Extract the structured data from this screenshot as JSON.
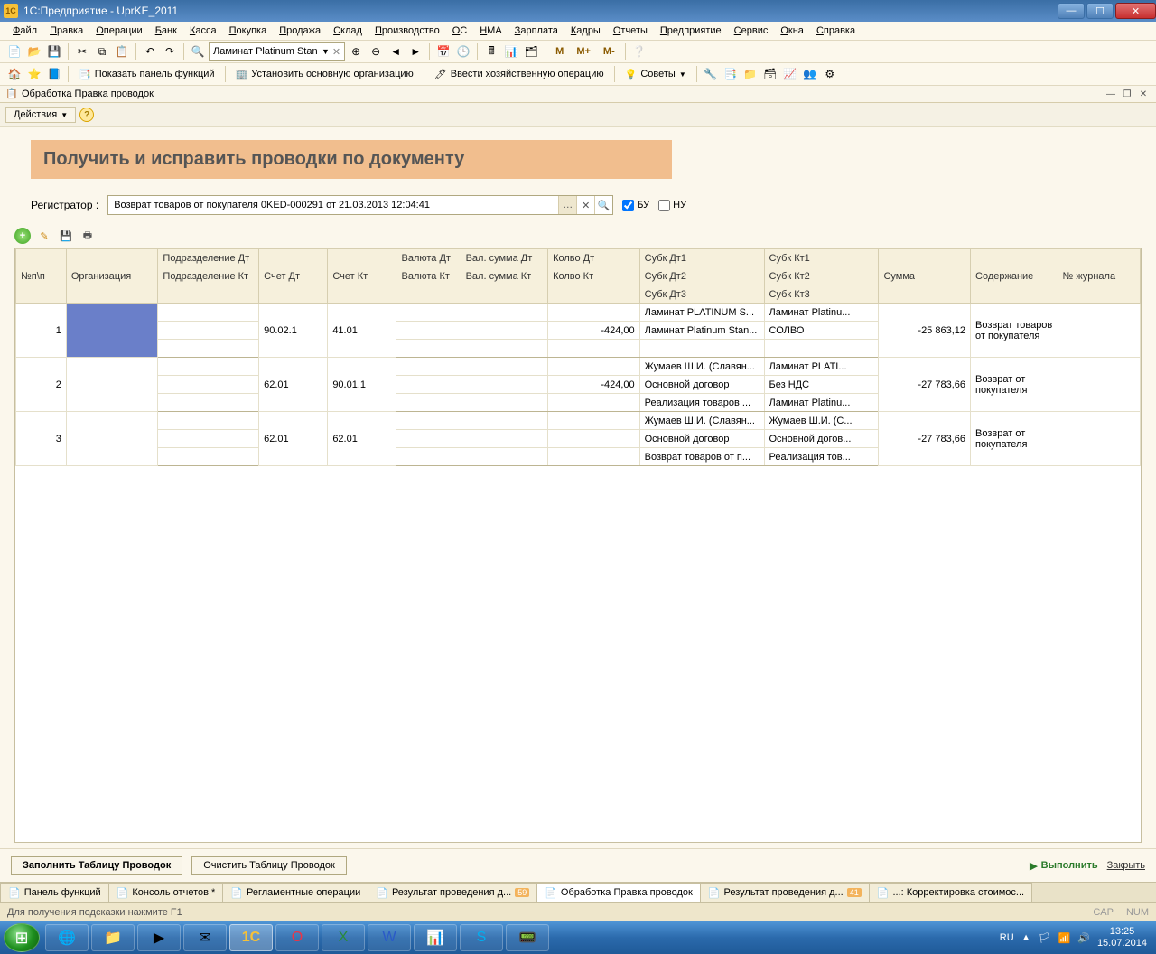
{
  "window": {
    "title": "1С:Предприятие - UprKE_2011"
  },
  "menu": [
    "Файл",
    "Правка",
    "Операции",
    "Банк",
    "Касса",
    "Покупка",
    "Продажа",
    "Склад",
    "Производство",
    "ОС",
    "НМА",
    "Зарплата",
    "Кадры",
    "Отчеты",
    "Предприятие",
    "Сервис",
    "Окна",
    "Справка"
  ],
  "toolbar1": {
    "combo_value": "Ламинат Platinum Stan",
    "m_labels": [
      "M",
      "M+",
      "M-"
    ]
  },
  "toolbar2": {
    "show_panel": "Показать панель функций",
    "set_org": "Установить основную организацию",
    "enter_op": "Ввести хозяйственную операцию",
    "tips": "Советы"
  },
  "subwin": {
    "title": "Обработка  Правка проводок"
  },
  "actions": {
    "label": "Действия"
  },
  "banner": "Получить и исправить проводки по документу",
  "registrator": {
    "label": "Регистратор :",
    "value": "Возврат товаров от покупателя 0KED-000291 от 21.03.2013 12:04:41",
    "bu": "БУ",
    "nu": "НУ"
  },
  "grid": {
    "headers": {
      "n": "№п\\п",
      "org": "Организация",
      "podr_dt": "Подразделение Дт",
      "podr_kt": "Подразделение Кт",
      "sch_dt": "Счет Дт",
      "sch_kt": "Счет Кт",
      "val_dt": "Валюта Дт",
      "val_kt": "Валюта Кт",
      "vsum_dt": "Вал. сумма Дт",
      "vsum_kt": "Вал. сумма Кт",
      "kol_dt": "Колво Дт",
      "kol_kt": "Колво Кт",
      "sub_dt1": "Субк Дт1",
      "sub_dt2": "Субк Дт2",
      "sub_dt3": "Субк Дт3",
      "sub_kt1": "Субк Кт1",
      "sub_kt2": "Субк Кт2",
      "sub_kt3": "Субк Кт3",
      "sum": "Сумма",
      "content": "Содержание",
      "journal": "№ журнала"
    },
    "rows": [
      {
        "n": "1",
        "sch_dt": "90.02.1",
        "sch_kt": "41.01",
        "kol_kt": "-424,00",
        "sdt": [
          "Ламинат PLATINUM S...",
          "Ламинат Platinum Stan...",
          ""
        ],
        "skt": [
          "Ламинат Platinu...",
          "СОЛВО",
          ""
        ],
        "sum": "-25 863,12",
        "content": "Возврат товаров от покупателя",
        "sel": true
      },
      {
        "n": "2",
        "sch_dt": "62.01",
        "sch_kt": "90.01.1",
        "kol_kt": "-424,00",
        "sdt": [
          "Жумаев Ш.И. (Славян...",
          "Основной договор",
          "Реализация товаров ..."
        ],
        "skt": [
          "Ламинат PLATI...",
          "Без НДС",
          "Ламинат Platinu..."
        ],
        "sum": "-27 783,66",
        "content": "Возврат от покупателя"
      },
      {
        "n": "3",
        "sch_dt": "62.01",
        "sch_kt": "62.01",
        "kol_kt": "",
        "sdt": [
          "Жумаев Ш.И. (Славян...",
          "Основной договор",
          "Возврат товаров от п..."
        ],
        "skt": [
          "Жумаев Ш.И. (С...",
          "Основной догов...",
          "Реализация тов..."
        ],
        "sum": "-27 783,66",
        "content": "Возврат от покупателя"
      }
    ]
  },
  "footer": {
    "fill": "Заполнить Таблицу Проводок",
    "clear": "Очистить Таблицу Проводок",
    "run": "Выполнить",
    "close": "Закрыть"
  },
  "tabs": [
    {
      "label": "Панель функций"
    },
    {
      "label": "Консоль отчетов *"
    },
    {
      "label": "Регламентные операции"
    },
    {
      "label": "Результат проведения д...",
      "badge": "59"
    },
    {
      "label": "Обработка  Правка проводок",
      "active": true
    },
    {
      "label": "Результат проведения д...",
      "badge": "41"
    },
    {
      "label": "...:  Корректировка стоимос..."
    }
  ],
  "status": {
    "hint": "Для получения подсказки нажмите F1",
    "cap": "CAP",
    "num": "NUM"
  },
  "tray": {
    "lang": "RU",
    "time": "13:25",
    "date": "15.07.2014"
  }
}
